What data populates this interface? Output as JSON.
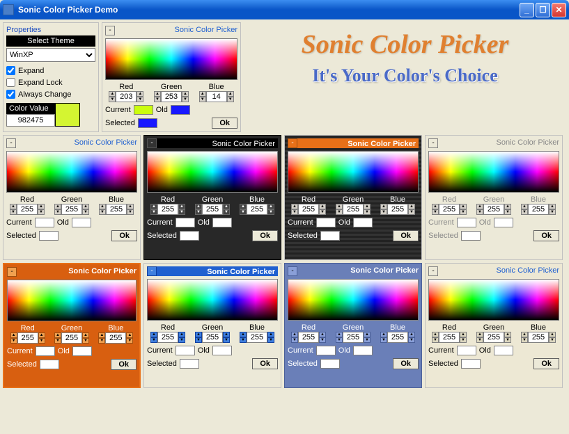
{
  "window": {
    "title": "Sonic Color Picker Demo"
  },
  "brand": {
    "title": "Sonic Color Picker",
    "subtitle": "It's Your Color's Choice"
  },
  "properties": {
    "title": "Properties",
    "select_theme_label": "Select Theme",
    "theme_value": "WinXP",
    "expand_label": "Expand",
    "expand_checked": true,
    "expand_lock_label": "Expand Lock",
    "expand_lock_checked": false,
    "always_change_label": "Always Change",
    "always_change_checked": true,
    "color_value_label": "Color Value",
    "color_value": "982475",
    "swatch_color": "#d4f531"
  },
  "main_picker": {
    "title": "Sonic Color Picker",
    "red_label": "Red",
    "red": "203",
    "green_label": "Green",
    "green": "253",
    "blue_label": "Blue",
    "blue": "14",
    "current_label": "Current",
    "current_color": "#cbfd0e",
    "old_label": "Old",
    "old_color": "#1818ff",
    "selected_label": "Selected",
    "selected_color": "#1818ff",
    "ok_label": "Ok",
    "toggle": "-"
  },
  "pickers": [
    {
      "title": "Sonic Color Picker",
      "theme": "",
      "red": "255",
      "green": "255",
      "blue": "255",
      "red_label": "Red",
      "green_label": "Green",
      "blue_label": "Blue",
      "current_label": "Current",
      "old_label": "Old",
      "selected_label": "Selected",
      "ok_label": "Ok",
      "toggle": "-",
      "current_color": "#ffffff",
      "old_color": "#ffffff",
      "selected_color": "#ffffff"
    },
    {
      "title": "Sonic Color Picker",
      "theme": "theme-dark",
      "red": "255",
      "green": "255",
      "blue": "255",
      "red_label": "Red",
      "green_label": "Green",
      "blue_label": "Blue",
      "current_label": "Current",
      "old_label": "Old",
      "selected_label": "Selected",
      "ok_label": "Ok",
      "toggle": "-",
      "current_color": "#ffffff",
      "old_color": "#ffffff",
      "selected_color": "#ffffff"
    },
    {
      "title": "Sonic Color Picker",
      "theme": "theme-orange-hdr",
      "red": "255",
      "green": "255",
      "blue": "255",
      "red_label": "Red",
      "green_label": "Green",
      "blue_label": "Blue",
      "current_label": "Current",
      "old_label": "Old",
      "selected_label": "Selected",
      "ok_label": "Ok",
      "toggle": "-",
      "current_color": "#ffffff",
      "old_color": "#ffffff",
      "selected_color": "#ffffff"
    },
    {
      "title": "Sonic Color Picker",
      "theme": "theme-gray",
      "red": "255",
      "green": "255",
      "blue": "255",
      "red_label": "Red",
      "green_label": "Green",
      "blue_label": "Blue",
      "current_label": "Current",
      "old_label": "Old",
      "selected_label": "Selected",
      "ok_label": "Ok",
      "toggle": "-",
      "current_color": "#ffffff",
      "old_color": "#ffffff",
      "selected_color": "#ffffff"
    },
    {
      "title": "Sonic Color Picker",
      "theme": "theme-orange-full",
      "red": "255",
      "green": "255",
      "blue": "255",
      "red_label": "Red",
      "green_label": "Green",
      "blue_label": "Blue",
      "current_label": "Current",
      "old_label": "Old",
      "selected_label": "Selected",
      "ok_label": "Ok",
      "toggle": "-",
      "current_color": "#ffffff",
      "old_color": "#ffffff",
      "selected_color": "#ffffff"
    },
    {
      "title": "Sonic Color Picker",
      "theme": "theme-blue-hdr",
      "red": "255",
      "green": "255",
      "blue": "255",
      "red_label": "Red",
      "green_label": "Green",
      "blue_label": "Blue",
      "current_label": "Current",
      "old_label": "Old",
      "selected_label": "Selected",
      "ok_label": "Ok",
      "toggle": "-",
      "current_color": "#ffffff",
      "old_color": "#ffffff",
      "selected_color": "#ffffff"
    },
    {
      "title": "Sonic Color Picker",
      "theme": "theme-slate",
      "red": "255",
      "green": "255",
      "blue": "255",
      "red_label": "Red",
      "green_label": "Green",
      "blue_label": "Blue",
      "current_label": "Current",
      "old_label": "Old",
      "selected_label": "Selected",
      "ok_label": "Ok",
      "toggle": "-",
      "current_color": "#ffffff",
      "old_color": "#ffffff",
      "selected_color": "#ffffff"
    },
    {
      "title": "Sonic Color Picker",
      "theme": "theme-cream",
      "red": "255",
      "green": "255",
      "blue": "255",
      "red_label": "Red",
      "green_label": "Green",
      "blue_label": "Blue",
      "current_label": "Current",
      "old_label": "Old",
      "selected_label": "Selected",
      "ok_label": "Ok",
      "toggle": "-",
      "current_color": "#ffffff",
      "old_color": "#ffffff",
      "selected_color": "#ffffff"
    }
  ]
}
